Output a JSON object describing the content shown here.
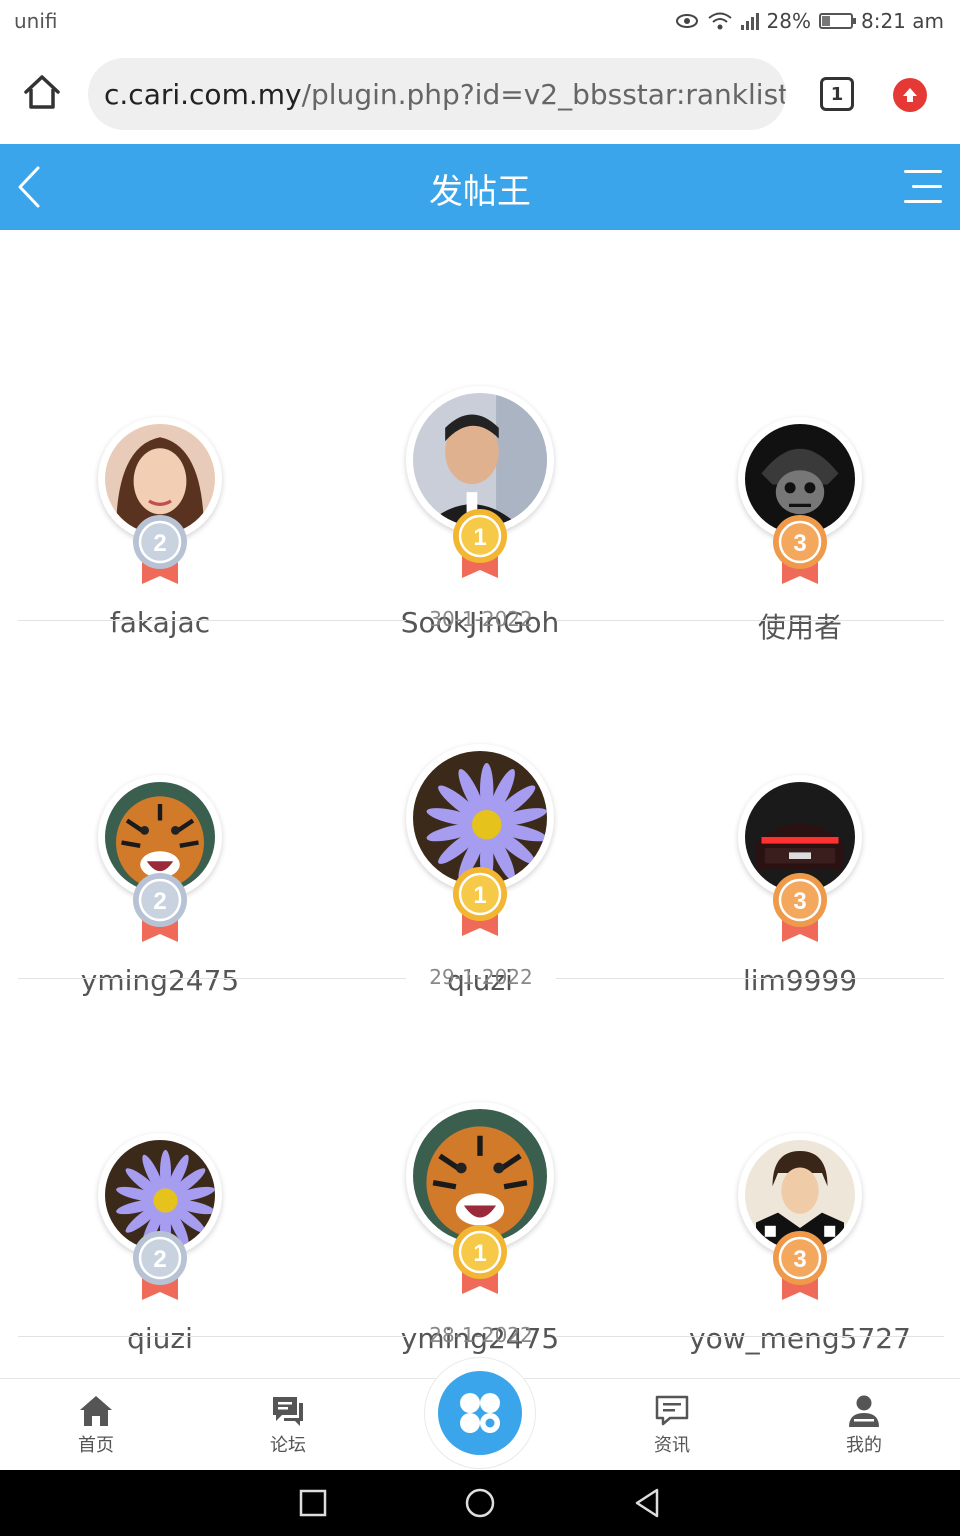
{
  "status_bar": {
    "carrier": "unifi",
    "battery": "28%",
    "battery_level": 0.28,
    "time": "8:21 am"
  },
  "browser": {
    "url_host": "c.cari.com.my",
    "url_path": "/plugin.php?id=v2_bbsstar:ranklist&ty",
    "tab_count": "1",
    "icons": [
      "home-icon",
      "tab-switcher-icon",
      "update-icon"
    ]
  },
  "header": {
    "title": "发帖王",
    "icons": [
      "back-arrow-icon",
      "menu-icon"
    ]
  },
  "ranking": {
    "days": [
      {
        "date": "30-1-2022",
        "ranks": [
          {
            "place": "2",
            "username": "fakajac",
            "avatar": "woman-portrait"
          },
          {
            "place": "1",
            "username": "SookJinGoh",
            "avatar": "man-portrait"
          },
          {
            "place": "3",
            "username": "使用者",
            "avatar": "dark-skull-helmet"
          }
        ]
      },
      {
        "date": "29-1-2022",
        "ranks": [
          {
            "place": "2",
            "username": "yming2475",
            "avatar": "tiger"
          },
          {
            "place": "1",
            "username": "qiuzi",
            "avatar": "purple-daisy"
          },
          {
            "place": "3",
            "username": "lim9999",
            "avatar": "red-car"
          }
        ]
      },
      {
        "date": "28-1-2022",
        "ranks": [
          {
            "place": "2",
            "username": "qiuzi",
            "avatar": "purple-daisy"
          },
          {
            "place": "1",
            "username": "yming2475",
            "avatar": "tiger"
          },
          {
            "place": "3",
            "username": "yow_meng5727",
            "avatar": "man-portrait-checkered"
          }
        ]
      }
    ]
  },
  "bottom_nav": {
    "items": [
      {
        "label": "首页",
        "icon": "home-icon"
      },
      {
        "label": "论坛",
        "icon": "forum-icon"
      },
      {
        "label": "",
        "icon": "apps-grid-icon"
      },
      {
        "label": "资讯",
        "icon": "news-icon"
      },
      {
        "label": "我的",
        "icon": "user-icon"
      }
    ]
  },
  "colors": {
    "brand_blue": "#3aa5ea",
    "gold_medal": "#f2b632",
    "silver_medal": "#b7c3d4",
    "bronze_medal": "#ef9a4b",
    "ribbon": "#f06a5a"
  }
}
